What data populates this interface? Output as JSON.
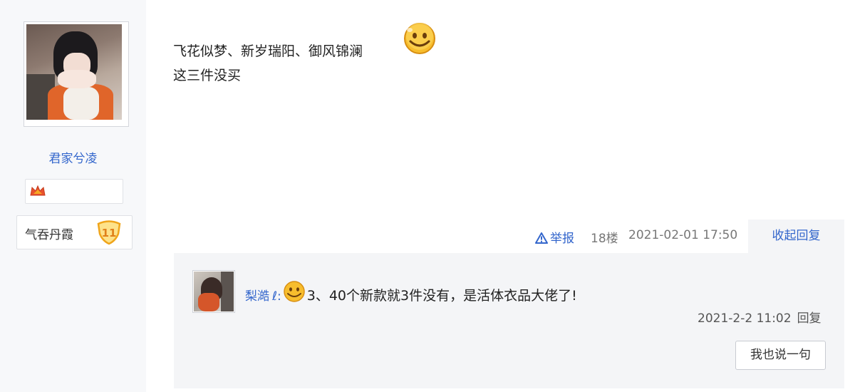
{
  "user": {
    "name": "君家兮凌",
    "rank_title": "气吞丹霞",
    "level": "11"
  },
  "post": {
    "line1": "飞花似梦、新岁瑞阳、御风锦澜",
    "line2": "这三件没买",
    "report_label": "举报",
    "floor": "18楼",
    "time": "2021-02-01 17:50",
    "collapse_reply_label": "收起回复"
  },
  "reply": {
    "author": "梨澔",
    "author_suffix": "ℓ:",
    "text": "3、40个新款就3件没有，是活体衣品大佬了!",
    "time": "2021-2-2 11:02",
    "reply_label": "回复",
    "say_button_label": "我也说一句"
  },
  "colors": {
    "link": "#3366cc",
    "panel_bg": "#f4f5f7",
    "sidebar_bg": "#f7f8fa",
    "smiley": "#f5b41e"
  }
}
